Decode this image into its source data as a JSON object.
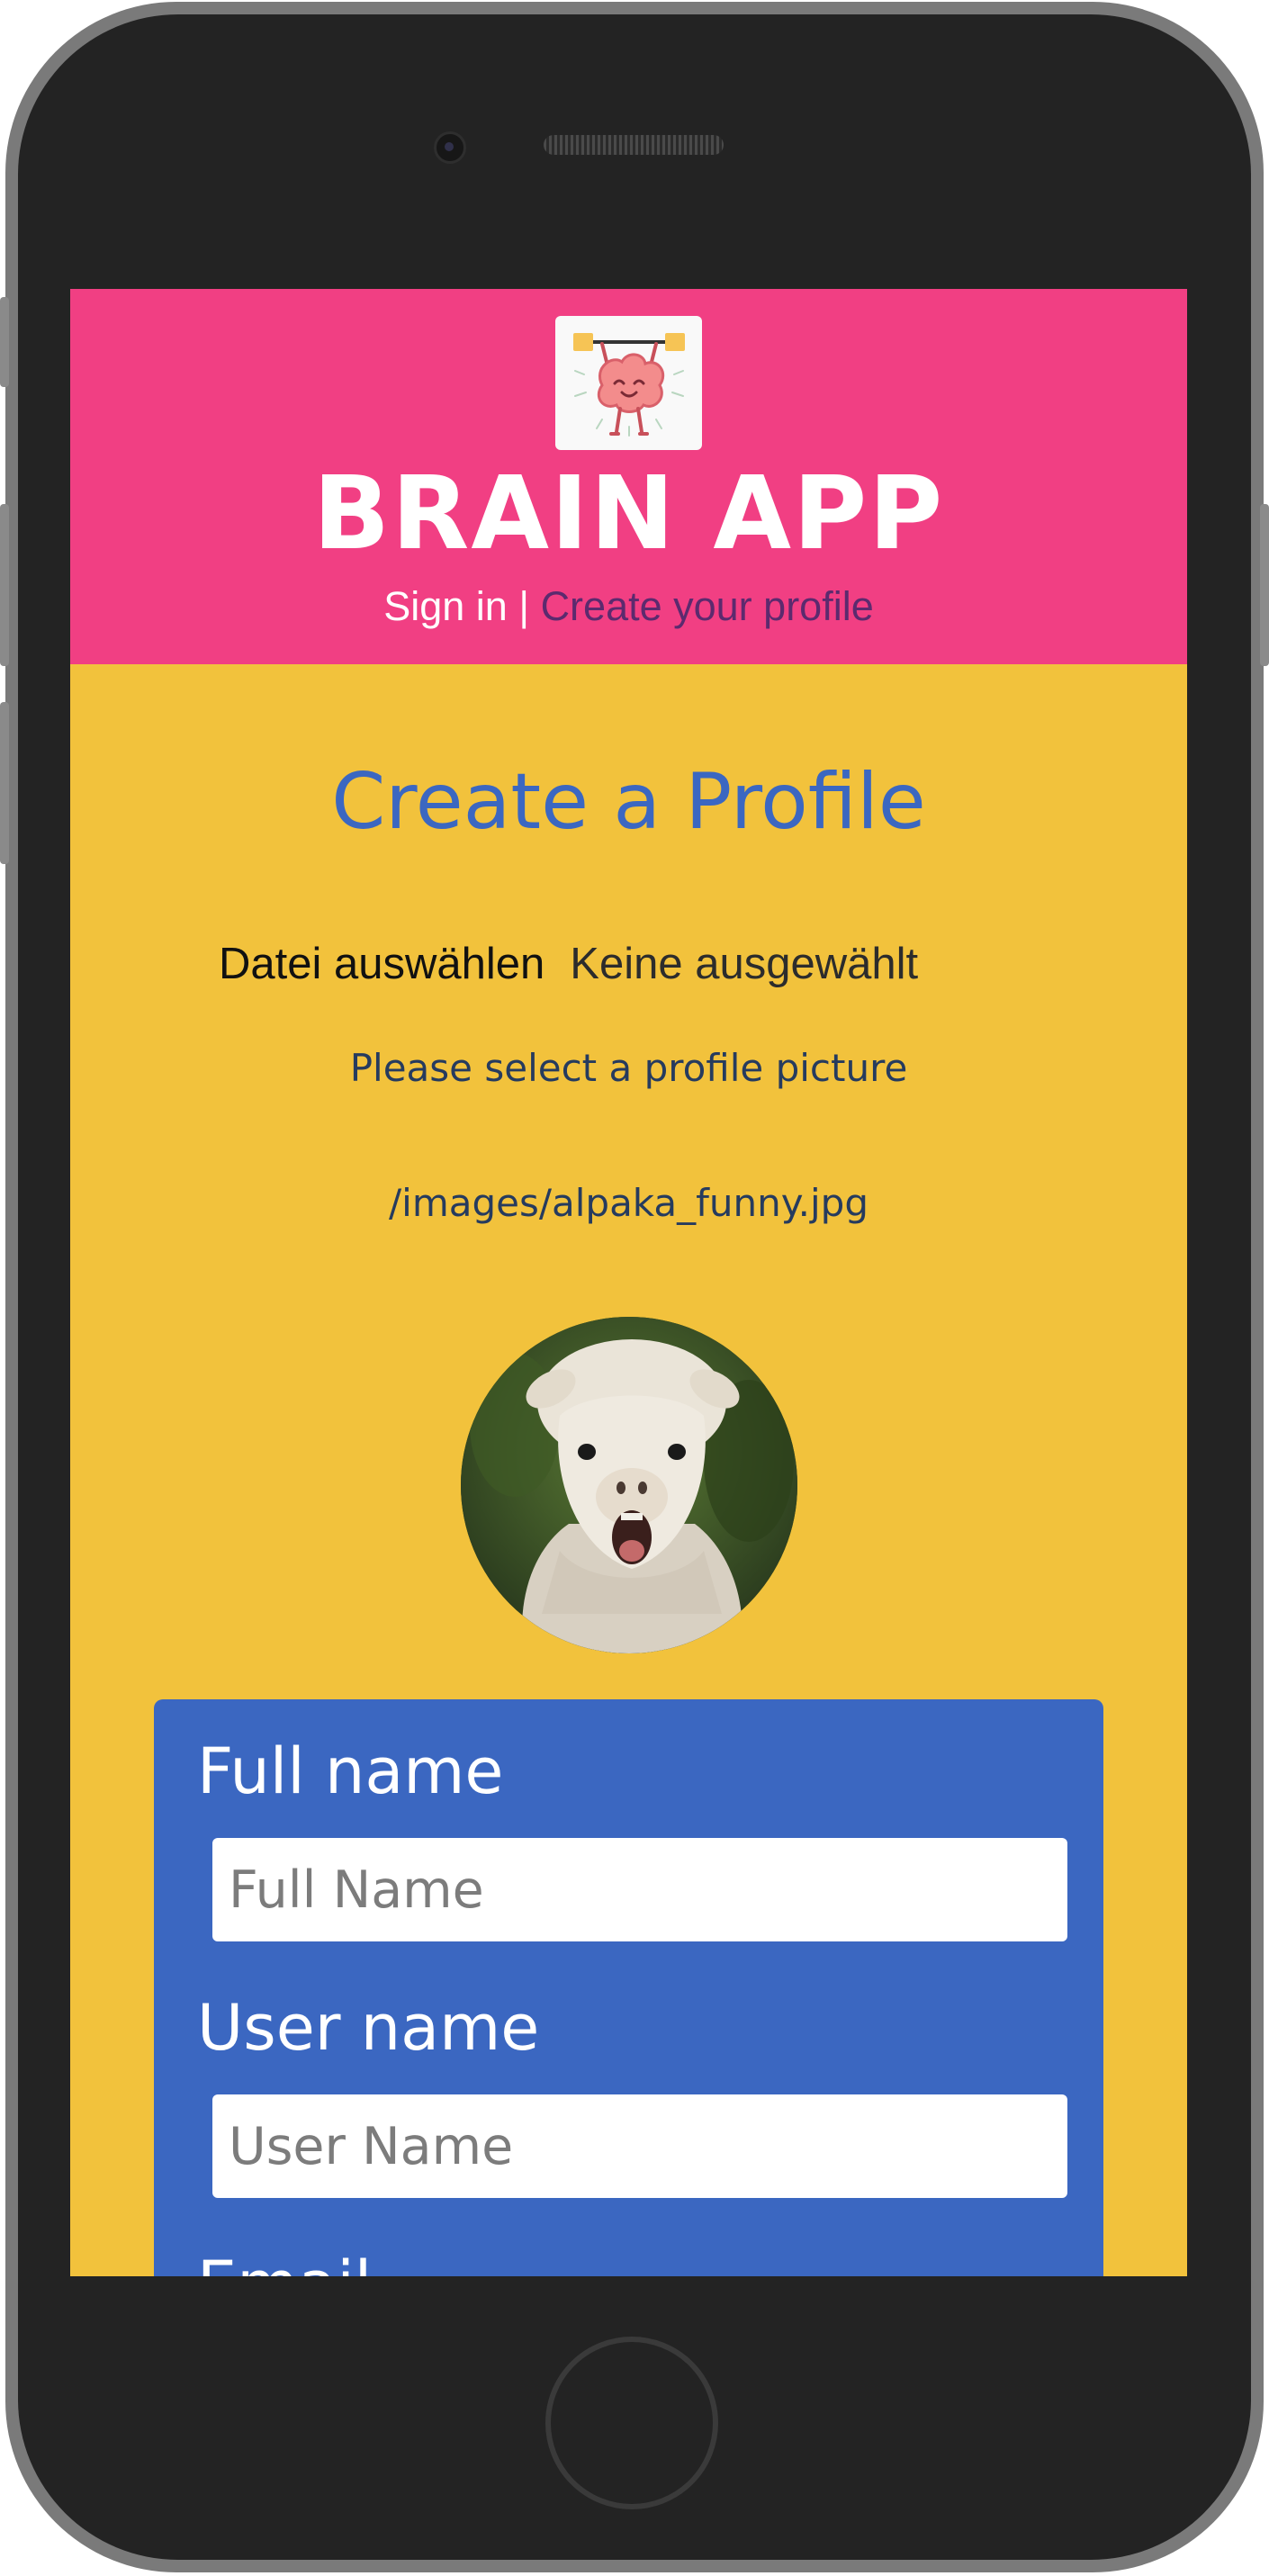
{
  "app": {
    "name": "BRAIN APP",
    "nav": {
      "sign_in": "Sign in",
      "separator": "|",
      "create_profile": "Create your profile"
    }
  },
  "page": {
    "title": "Create a Profile",
    "file_picker": {
      "button_label": "Datei auswählen",
      "status": "Keine ausgewählt"
    },
    "hint": "Please select a profile picture",
    "image_path": "/images/alpaka_funny.jpg"
  },
  "form": {
    "full_name": {
      "label": "Full name",
      "placeholder": "Full Name"
    },
    "user_name": {
      "label": "User name",
      "placeholder": "User Name"
    },
    "email": {
      "label": "Email"
    }
  },
  "colors": {
    "header": "#f13f83",
    "background": "#f2c23c",
    "accent_blue": "#3b67c1",
    "nav_active": "#5c2a6e"
  },
  "icons": {
    "logo": "brain-lifting-barbell-icon",
    "avatar": "alpaca-photo"
  }
}
